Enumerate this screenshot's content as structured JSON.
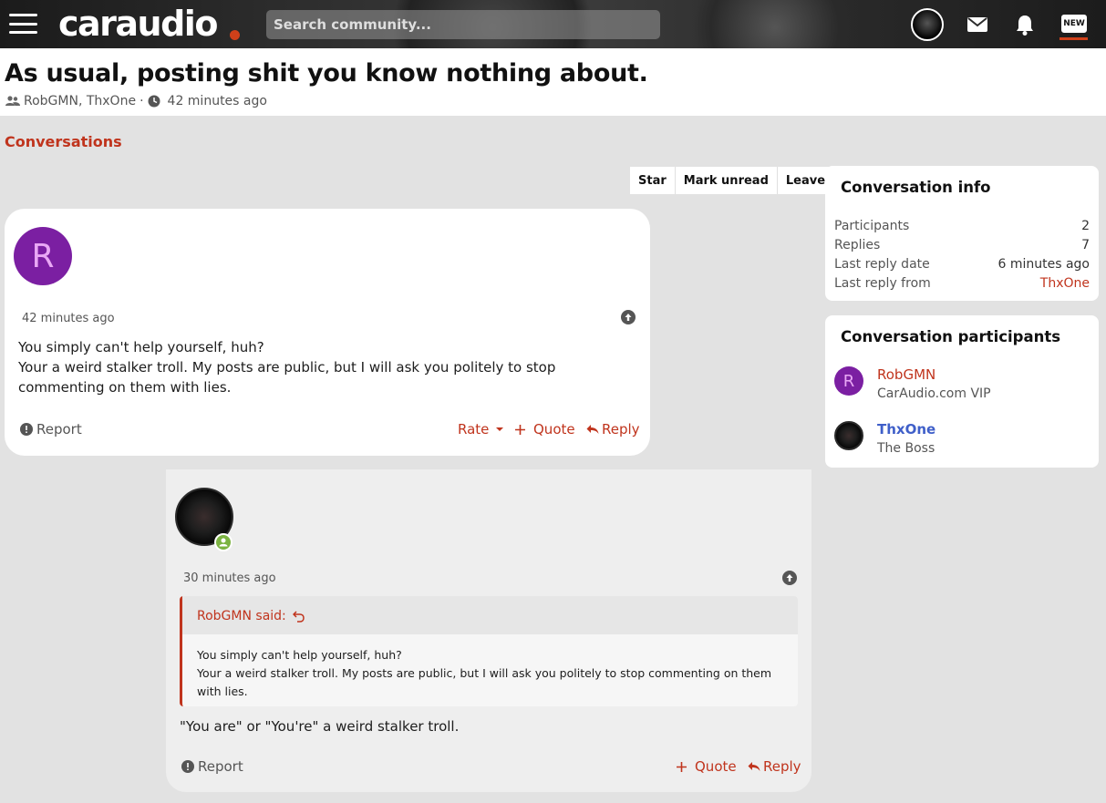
{
  "topbar": {
    "logo_text": "caraudio",
    "search_placeholder": "Search community...",
    "new_badge": "NEW",
    "accent_color": "#d0401a"
  },
  "header": {
    "title": "As usual, posting shit you know nothing about.",
    "participants": "RobGMN, ThxOne",
    "separator": "·",
    "time": "42 minutes ago"
  },
  "breadcrumb": "Conversations",
  "actions": {
    "star": "Star",
    "mark_unread": "Mark unread",
    "leave": "Leave"
  },
  "messages": [
    {
      "avatar_letter": "R",
      "time": "42 minutes ago",
      "body_line1": "You simply can't help yourself, huh?",
      "body_line2": "Your a weird stalker troll. My posts are public, but I will ask you politely to stop commenting on them with lies.",
      "report": "Report",
      "rate": "Rate",
      "quote": "Quote",
      "reply": "Reply"
    },
    {
      "time": "30 minutes ago",
      "quote_author": "RobGMN said:",
      "quote_line1": "You simply can't help yourself, huh?",
      "quote_line2": "Your a weird stalker troll. My posts are public, but I will ask you politely to stop commenting on them with lies.",
      "body": "\"You are\" or \"You're\" a weird stalker troll.",
      "report": "Report",
      "quote": "Quote",
      "reply": "Reply"
    }
  ],
  "sidebar": {
    "info_title": "Conversation info",
    "info": [
      {
        "label": "Participants",
        "value": "2"
      },
      {
        "label": "Replies",
        "value": "7"
      },
      {
        "label": "Last reply date",
        "value": "6 minutes ago"
      },
      {
        "label": "Last reply from",
        "value": "ThxOne"
      }
    ],
    "participants_title": "Conversation participants",
    "participants": [
      {
        "name": "RobGMN",
        "role": "CarAudio.com VIP",
        "avatar_letter": "R"
      },
      {
        "name": "ThxOne",
        "role": "The Boss"
      }
    ]
  }
}
